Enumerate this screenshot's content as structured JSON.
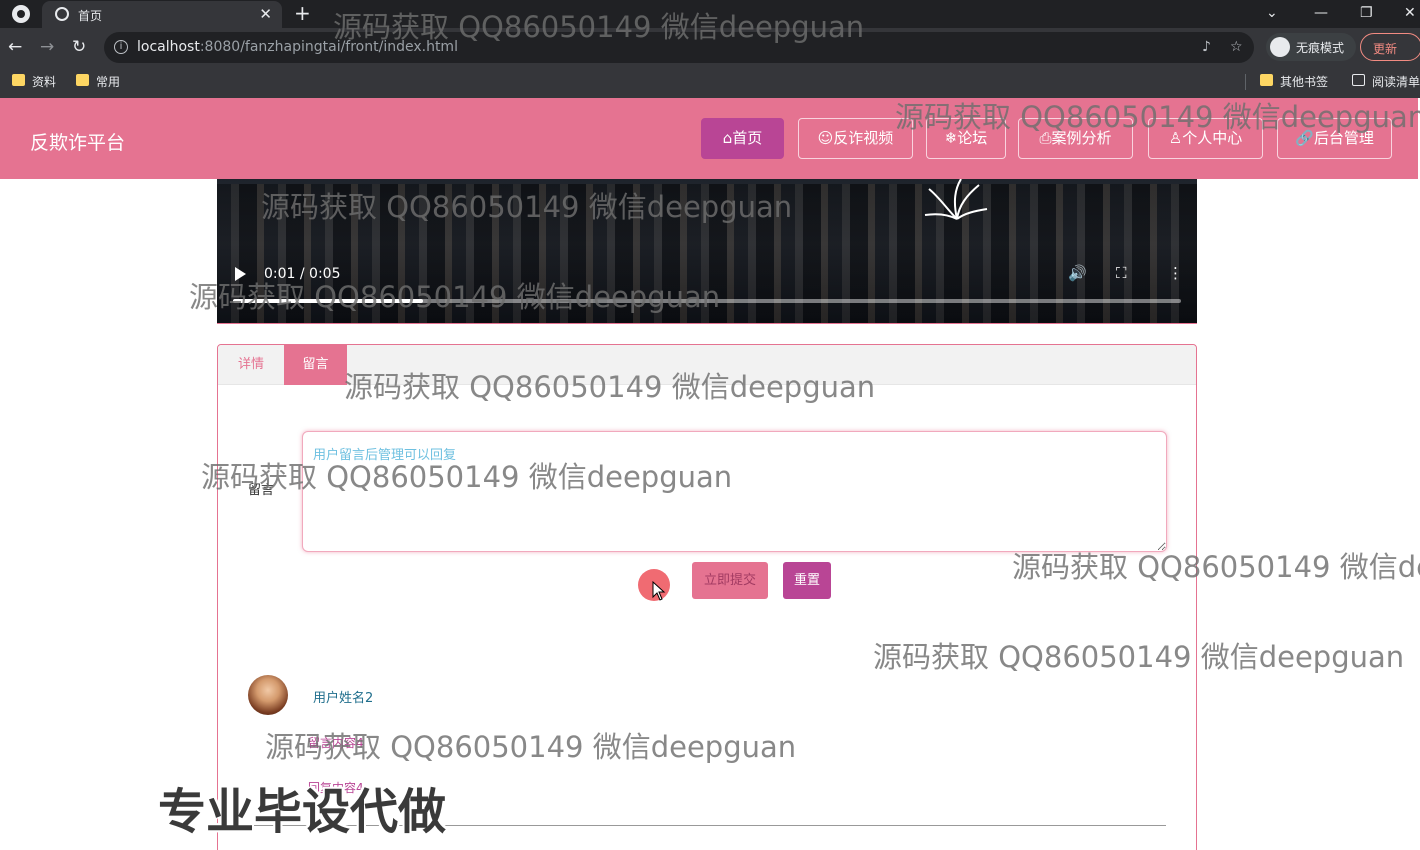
{
  "browser": {
    "tab_title": "首页",
    "url_host": "localhost",
    "url_rest": ":8080/fanzhapingtai/front/index.html",
    "incognito_label": "无痕模式",
    "update_label": "更新",
    "bookmarks": [
      "资料",
      "常用",
      "其他书签",
      "阅读清单"
    ]
  },
  "header": {
    "site_title": "反欺诈平台",
    "nav": [
      {
        "label": "⌂首页",
        "active": true
      },
      {
        "label": "☺反诈视频",
        "active": false
      },
      {
        "label": "❄论坛",
        "active": false
      },
      {
        "label": "⎙案例分析",
        "active": false
      },
      {
        "label": "♙个人中心",
        "active": false
      },
      {
        "label": "🔗后台管理",
        "active": false
      }
    ]
  },
  "video": {
    "time": "0:01 / 0:05",
    "progress": 0.2
  },
  "panel": {
    "tabs": [
      "详情",
      "留言"
    ],
    "active_tab": "留言",
    "form_label": "留言",
    "textarea_placeholder": "用户留言后管理可以回复",
    "submit_label": "立即提交",
    "reset_label": "重置",
    "comment": {
      "user": "用户姓名2",
      "content": "留言内容4",
      "reply": "回复内容4"
    }
  },
  "watermark": {
    "text": "源码获取 QQ86050149 微信deepguan",
    "promo": "专业毕设代做"
  },
  "colors": {
    "brand": "#e57391",
    "brand_dark": "#b94595"
  }
}
